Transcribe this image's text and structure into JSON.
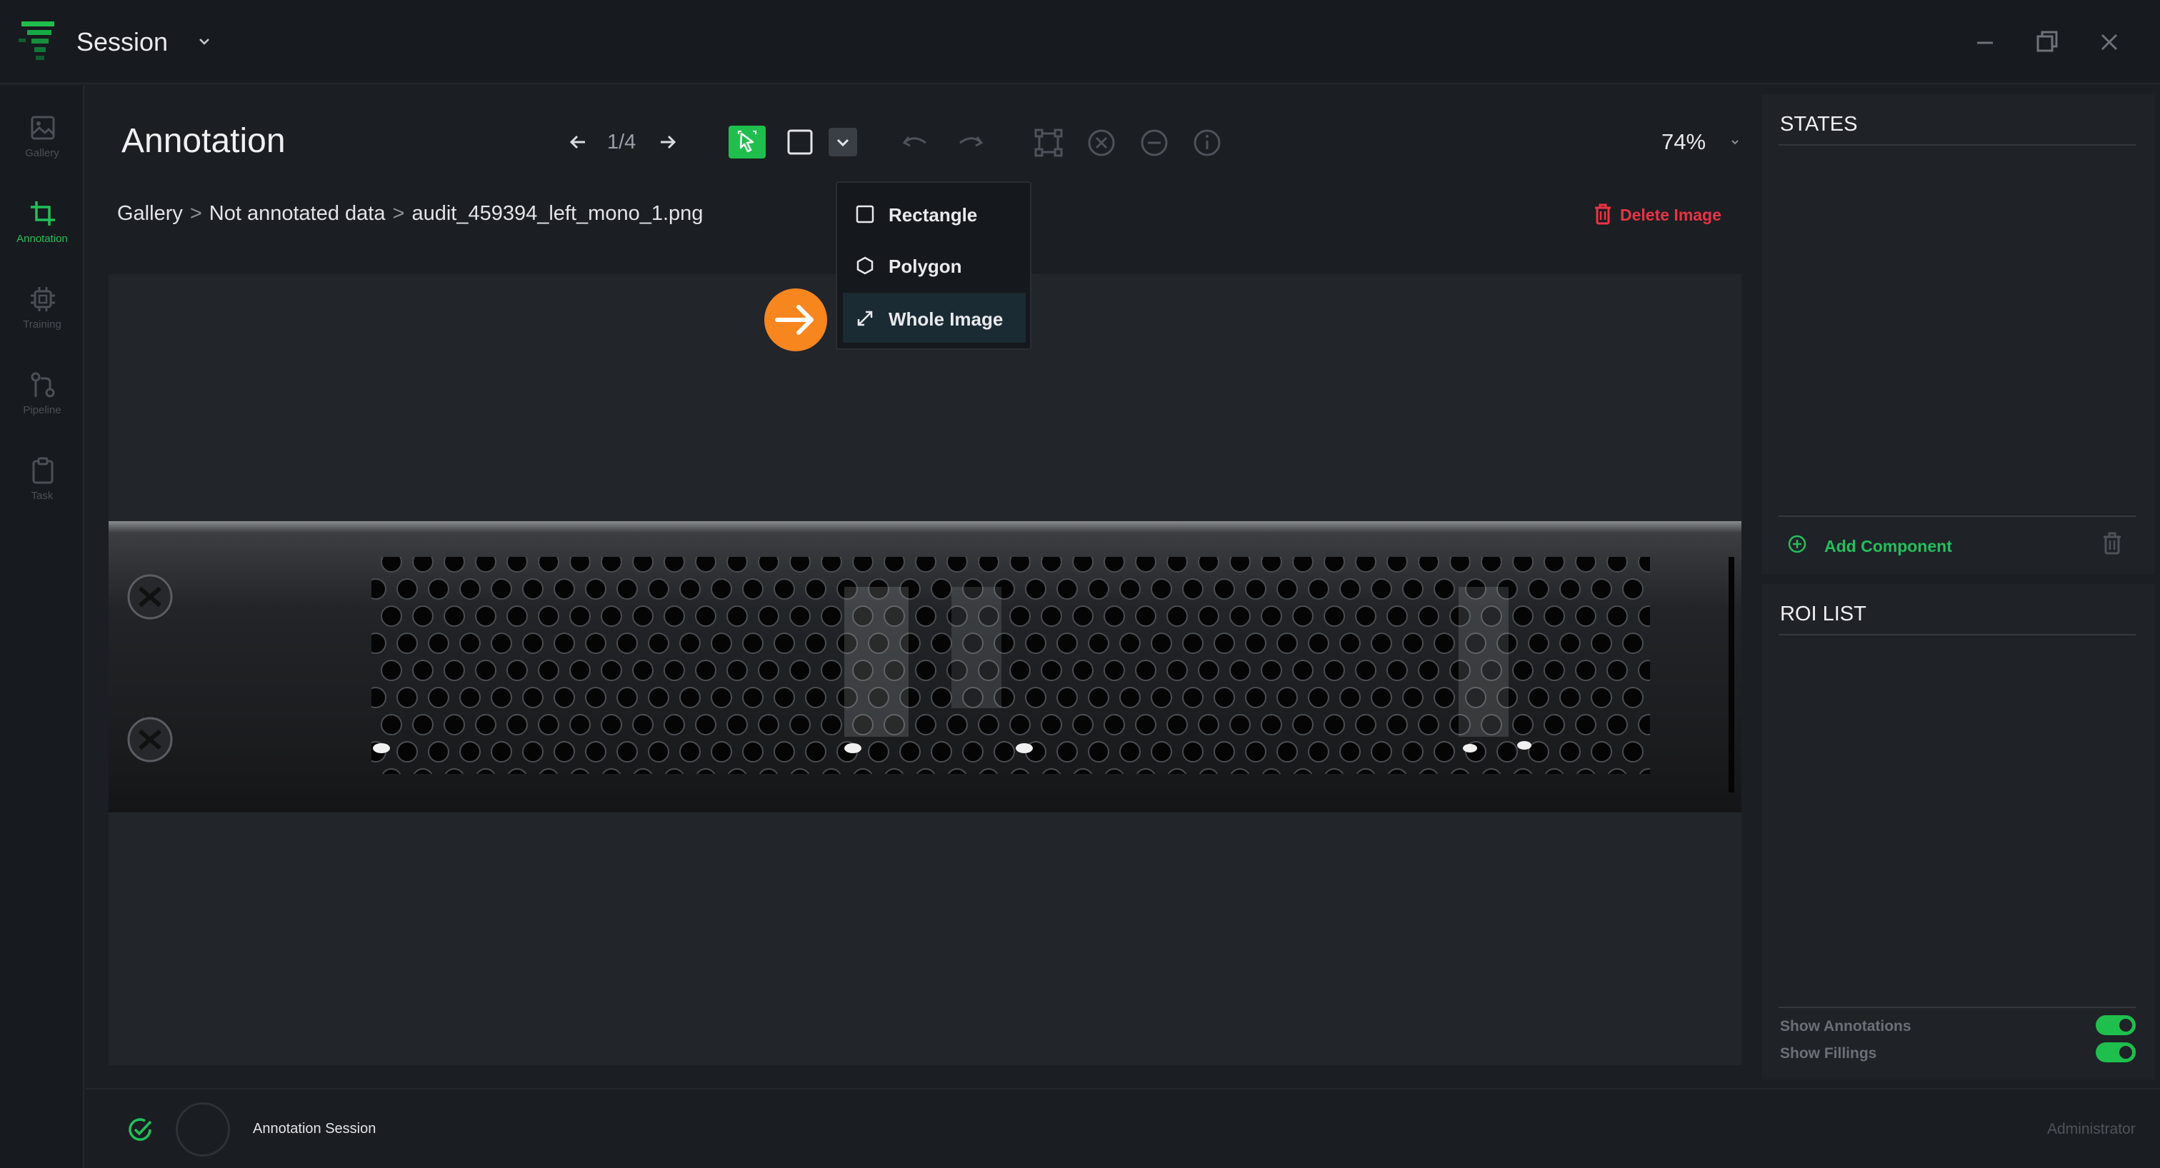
{
  "titlebar": {
    "title": "Session",
    "icons": [
      "app-logo-icon",
      "chevron-down-icon",
      "minimize-icon",
      "restore-icon",
      "close-icon"
    ]
  },
  "nav": {
    "items": [
      {
        "label": "Gallery",
        "icon": "image-icon",
        "active": false
      },
      {
        "label": "Annotation",
        "icon": "crop-icon",
        "active": true
      },
      {
        "label": "Training",
        "icon": "chip-icon",
        "active": false
      },
      {
        "label": "Pipeline",
        "icon": "pipeline-icon",
        "active": false
      },
      {
        "label": "Task",
        "icon": "clipboard-icon",
        "active": false
      }
    ]
  },
  "header": {
    "title": "Annotation",
    "pager": "1/4",
    "zoom": "74%"
  },
  "breadcrumb": {
    "items": [
      "Gallery",
      "Not annotated data",
      "audit_459394_left_mono_1.png"
    ],
    "separator": ">"
  },
  "actions": {
    "delete_image": "Delete Image"
  },
  "tool_menu": {
    "items": [
      {
        "label": "Rectangle",
        "icon": "square-icon"
      },
      {
        "label": "Polygon",
        "icon": "hexagon-icon"
      },
      {
        "label": "Whole Image",
        "icon": "expand-icon",
        "highlighted": true
      }
    ]
  },
  "states_panel": {
    "title": "STATES",
    "add_component": "Add Component"
  },
  "roi_panel": {
    "title": "ROI LIST",
    "toggles": [
      {
        "label": "Show Annotations",
        "on": true
      },
      {
        "label": "Show Fillings",
        "on": true
      }
    ]
  },
  "statusbar": {
    "session_label": "Annotation Session",
    "user": "Administrator"
  },
  "colors": {
    "accent_green": "#1fbf4d",
    "danger_red": "#ea3443",
    "callout_orange": "#f7861f",
    "background": "#1b1e23"
  }
}
